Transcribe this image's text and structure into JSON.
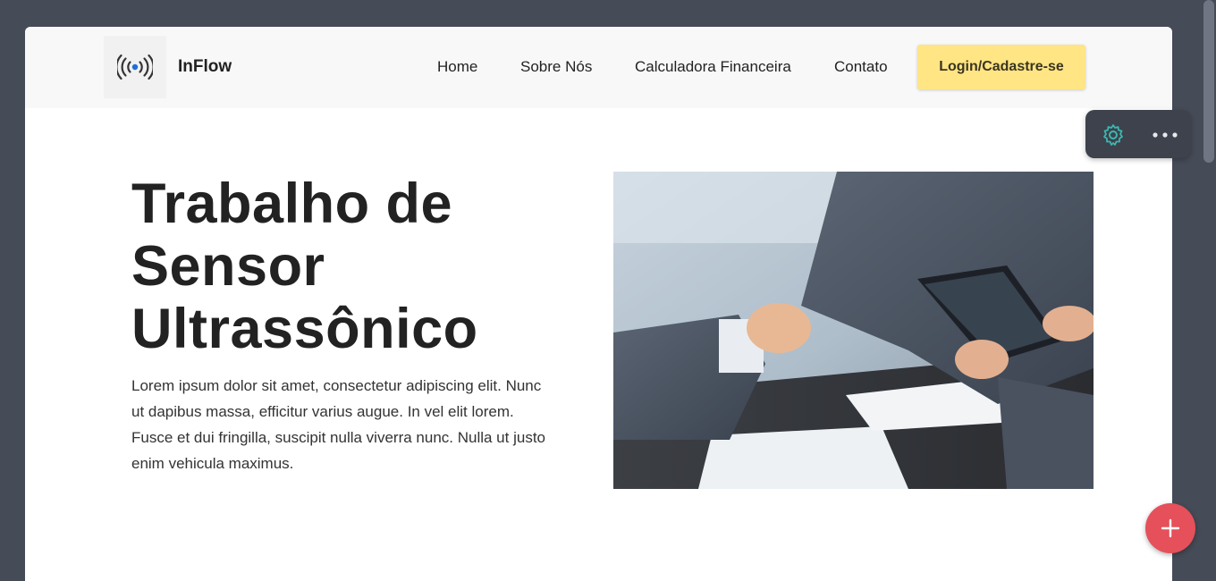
{
  "navbar": {
    "brand": "InFlow",
    "logo_icon": "broadcast-signal-icon",
    "links": [
      "Home",
      "Sobre Nós",
      "Calculadora Financeira",
      "Contato"
    ],
    "login_label": "Login/Cadastre-se"
  },
  "hero": {
    "title_lines": [
      "Trabalho de",
      "Sensor",
      "Ultrassônico"
    ],
    "paragraph": "Lorem ipsum dolor sit amet, consectetur adipiscing elit. Nunc ut dapibus massa, efficitur varius augue. In vel elit lorem. Fusce et dui fringilla, suscipit nulla viverra nunc. Nulla ut justo enim vehicula maximus.",
    "image_subject": "business-handshake-photo"
  },
  "toolbar": {
    "icons": [
      "gear-icon",
      "more-horizontal-icon"
    ]
  },
  "fab": {
    "icon": "plus-icon"
  },
  "colors": {
    "background": "#454b57",
    "navbar": "#f8f8f8",
    "login_button": "#ffe584",
    "fab": "#e5505a",
    "toolbar": "#3d424c",
    "gear_accent": "#3bb7b0",
    "logo_dot": "#1e6fd9"
  }
}
